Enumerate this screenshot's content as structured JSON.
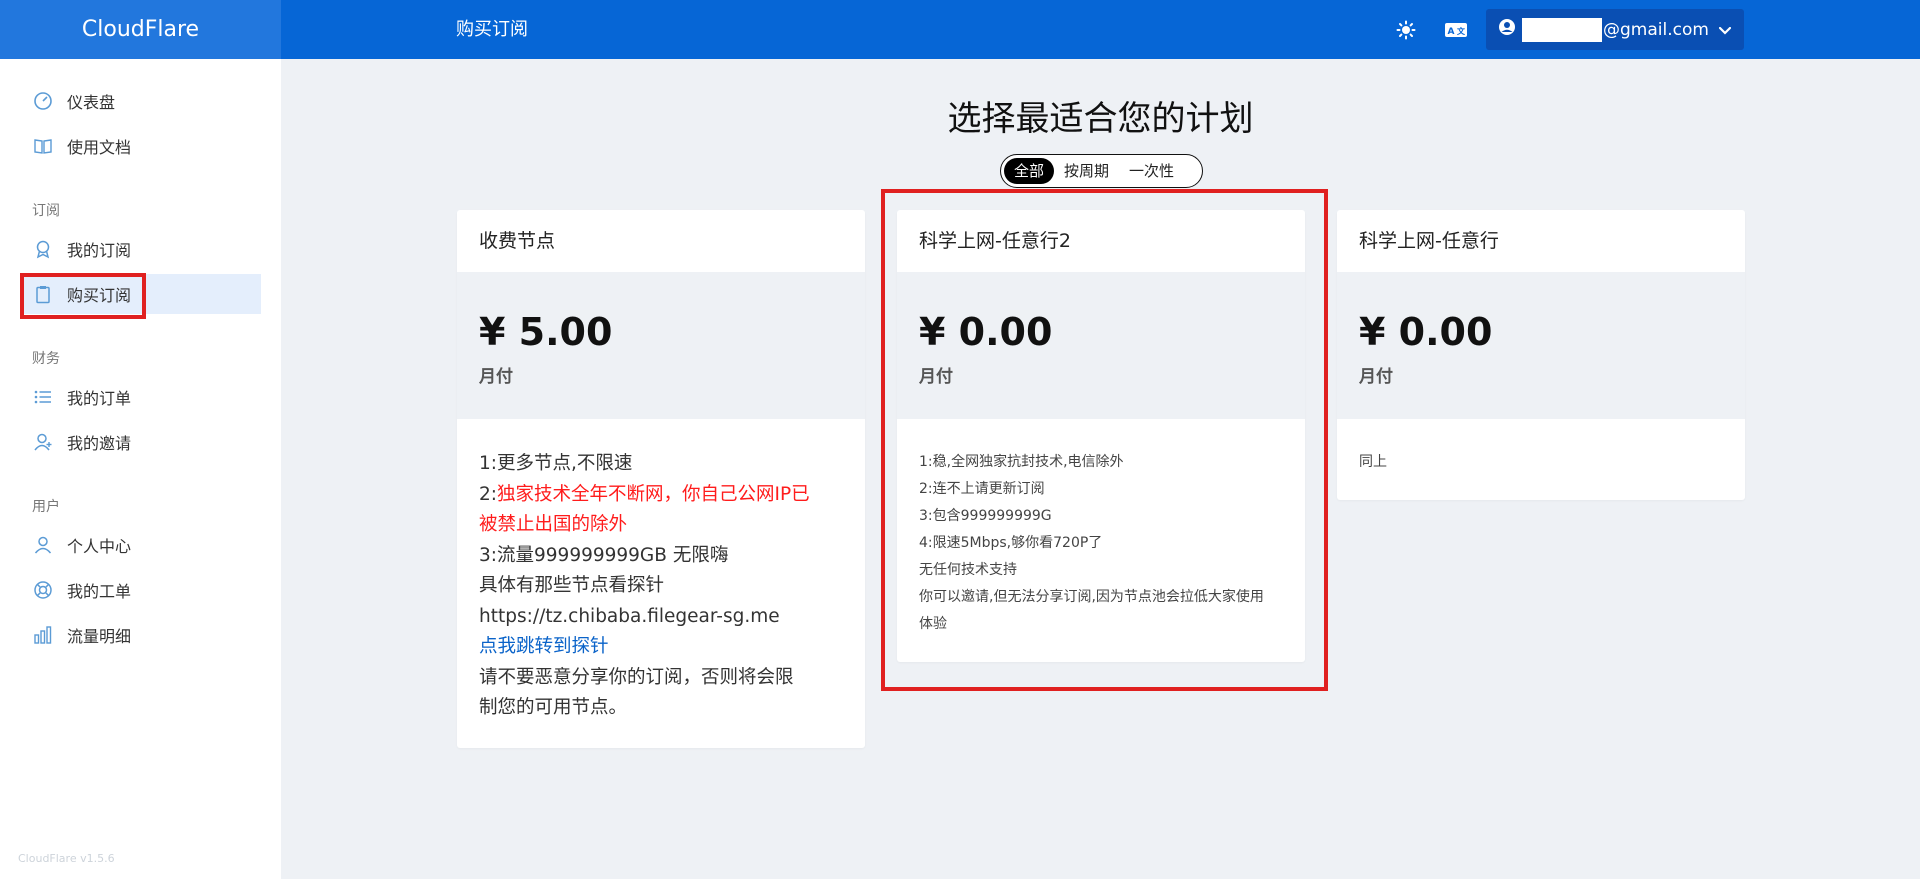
{
  "brand": "CloudFlare",
  "header": {
    "title": "购买订阅",
    "theme_icon": "sun-icon",
    "translate_icon": "translate-icon",
    "user_email_suffix": "@gmail.com"
  },
  "sidebar": {
    "items_top": [
      {
        "label": "仪表盘",
        "icon": "dashboard-gauge-icon"
      },
      {
        "label": "使用文档",
        "icon": "book-icon"
      }
    ],
    "section_subscribe": "订阅",
    "items_subscribe": [
      {
        "label": "我的订阅",
        "icon": "award-icon"
      },
      {
        "label": "购买订阅",
        "icon": "clipboard-icon",
        "active": true
      }
    ],
    "section_finance": "财务",
    "items_finance": [
      {
        "label": "我的订单",
        "icon": "list-icon"
      },
      {
        "label": "我的邀请",
        "icon": "user-plus-icon"
      }
    ],
    "section_user": "用户",
    "items_user": [
      {
        "label": "个人中心",
        "icon": "user-icon"
      },
      {
        "label": "我的工单",
        "icon": "lifebuoy-icon"
      },
      {
        "label": "流量明细",
        "icon": "bar-chart-icon"
      }
    ],
    "version": "CloudFlare v1.5.6"
  },
  "main": {
    "title": "选择最适合您的计划",
    "filters": [
      {
        "label": "全部",
        "selected": true
      },
      {
        "label": "按周期",
        "selected": false
      },
      {
        "label": "一次性",
        "selected": false
      }
    ],
    "plans": [
      {
        "name": "收费节点",
        "price": "¥ 5.00",
        "period": "月付",
        "lines": [
          "1:更多节点,不限速",
          "2:",
          "独家技术全年不断网，你自己公网IP已",
          "被禁止出国的除外",
          "3:流量999999999GB 无限嗨",
          "具体有那些节点看探针",
          "https://tz.chibaba.filegear-sg.me",
          "点我跳转到探针",
          "请不要恶意分享你的订阅，否则将会限",
          "制您的可用节点。"
        ]
      },
      {
        "name": "科学上网-任意行2",
        "price": "¥ 0.00",
        "period": "月付",
        "lines": [
          "1:稳,全网独家抗封技术,电信除外",
          "2:连不上请更新订阅",
          "3:包含999999999G",
          "4:限速5Mbps,够你看720P了",
          "无任何技术支持",
          "你可以邀请,但无法分享订阅,因为节点池会拉低大家使用",
          "体验"
        ]
      },
      {
        "name": "科学上网-任意行",
        "price": "¥ 0.00",
        "period": "月付",
        "lines": [
          "同上"
        ]
      }
    ]
  },
  "colors": {
    "header_bg": "#0666d6",
    "brand_bg": "#2277dd",
    "highlight_box": "#e02020",
    "active_nav_bg": "#e4eefc",
    "page_bg": "#eef1f5",
    "red_text": "#ff1c1c",
    "link_text": "#0a63c9"
  }
}
